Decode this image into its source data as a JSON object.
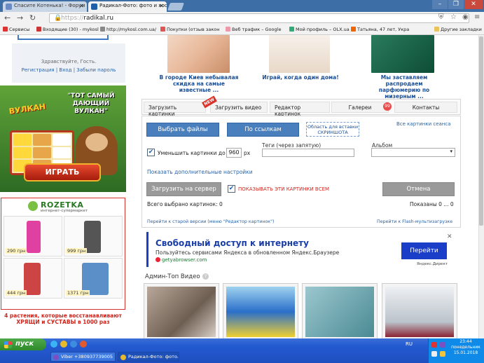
{
  "browser": {
    "tabs": [
      {
        "title": "Спасите Котенька! - Форум",
        "active": false
      },
      {
        "title": "Радикал-Фото: фото и хостинг",
        "active": true
      }
    ],
    "window_controls": [
      "–",
      "❐",
      "✕"
    ],
    "url_scheme": "https://",
    "url_host": "radikal.ru",
    "bookmarks": [
      "Сервисы",
      "Входящие (30) - mykosl",
      "http://mykosl.com.ua/",
      "Покупки (отзыв закон",
      "Веб трафик – Google",
      "Мой профиль – OLX.ua",
      "Татьяна, 47 лет, Укра",
      "Другие закладки"
    ]
  },
  "left": {
    "login_greeting": "Здравствуйте, Гость.",
    "login_links": "Регистрация | Вход | Забыли пароль",
    "casino_brand": "ВУЛКАН",
    "casino_title": "\"ТОТ САМЫЙ ДАЮЩИЙ ВУЛКАН\"",
    "play_button": "ИГРАТЬ",
    "rozetka_name": "ROZETKA",
    "rozetka_sub": "интернет-супермаркет",
    "products": [
      {
        "price": "290 грн"
      },
      {
        "price": "999 грн"
      },
      {
        "price": "444 грн"
      },
      {
        "price": "1371 грн"
      }
    ],
    "promo": "4 растения, которые восстанавливают ХРЯЩИ и СУСТАВЫ в 1000 раз"
  },
  "top_ads": [
    {
      "caption": "В городе Киев небывалая скидка на самые известные ..."
    },
    {
      "caption": "Играй, когда один дома!"
    },
    {
      "caption": "Мы заставляем распродаем парфюмерию по мизерным ..."
    }
  ],
  "upload": {
    "tabs": [
      "Загрузить картинки",
      "Загрузить видео",
      "Редактор картинок",
      "Галереи",
      "Контакты"
    ],
    "new_badge": "NEW",
    "gallery_count": "99",
    "files_button": "Выбрать файлы",
    "links_button": "По ссылкам",
    "screenshot_area": "Область для вставки СКРИНШОТА",
    "all_pictures_link": "Все картинки сеанса",
    "tags_label": "Теги (через запятую)",
    "album_label": "Альбом",
    "reduce_checked": true,
    "reduce_label": "Уменьшить картинки до",
    "reduce_value": "960",
    "reduce_unit": "px",
    "album_value": "▾",
    "more_settings": "Показать дополнительные настройки",
    "upload_button": "Загрузить на сервер",
    "show_all_checked": true,
    "show_all_label": "ПОКАЗЫВАТЬ ЭТИ КАРТИНКИ ВСЕМ",
    "cancel_button": "Отмена",
    "selected_count": "Всего выбрано картинок: 0",
    "shown_count": "Показаны 0 ... 0",
    "old_version_link": "Перейти к старой версии (меню \"Редактор картинок\")",
    "flash_link": "Перейти к Flash-мультизагрузке"
  },
  "yandex_ad": {
    "title": "Свободный доступ к интернету",
    "subtitle": "Пользуйтесь сервисами Яндекса в обновленном Яндекс.Браузере",
    "link": "getyabrowser.com",
    "button": "Перейти",
    "label": "Яндекс.Директ",
    "close": "✕"
  },
  "video": {
    "title": "Админ-Топ Видео",
    "help": "?"
  },
  "taskbar": {
    "start": "пуск",
    "items": [
      "Viber +380937739005",
      "Радикал-Фото: фото..."
    ],
    "language": "RU",
    "time": "23:44",
    "weekday": "понедельник",
    "date": "15.01.2018"
  }
}
